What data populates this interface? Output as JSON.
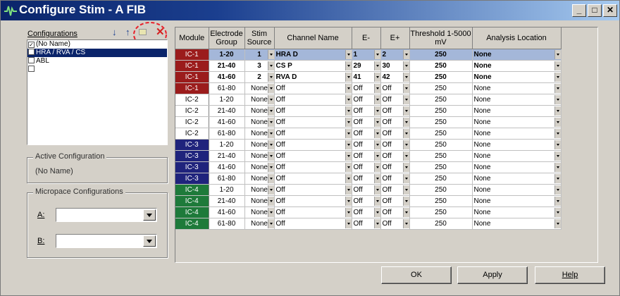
{
  "window": {
    "title": "Configure Stim - A FIB",
    "minimize": "_",
    "maximize": "□",
    "close": "✕"
  },
  "configs": {
    "label": "Configurations",
    "items": [
      {
        "label": "(No Name)",
        "checked": true,
        "selected": false
      },
      {
        "label": "HRA / RVA / CS",
        "checked": false,
        "selected": true
      },
      {
        "label": "ABL",
        "checked": false,
        "selected": false
      },
      {
        "label": "",
        "checked": false,
        "selected": false
      }
    ]
  },
  "active": {
    "label": "Active Configuration",
    "value": "(No Name)"
  },
  "micropace": {
    "label": "Micropace Configurations",
    "a_label": "A:",
    "b_label": "B:",
    "a_value": "",
    "b_value": ""
  },
  "table": {
    "headers": [
      "Module",
      "Electrode Group",
      "Stim Source",
      "Channel Name",
      "E-",
      "E+",
      "Threshold 1-5000 mV",
      "Analysis Location"
    ],
    "rows": [
      [
        "IC-1",
        "1-20",
        "1",
        "HRA D",
        "1",
        "2",
        "250",
        "None"
      ],
      [
        "IC-1",
        "21-40",
        "3",
        "CS P",
        "29",
        "30",
        "250",
        "None"
      ],
      [
        "IC-1",
        "41-60",
        "2",
        "RVA D",
        "41",
        "42",
        "250",
        "None"
      ],
      [
        "IC-1",
        "61-80",
        "None",
        "Off",
        "Off",
        "Off",
        "250",
        "None"
      ],
      [
        "IC-2",
        "1-20",
        "None",
        "Off",
        "Off",
        "Off",
        "250",
        "None"
      ],
      [
        "IC-2",
        "21-40",
        "None",
        "Off",
        "Off",
        "Off",
        "250",
        "None"
      ],
      [
        "IC-2",
        "41-60",
        "None",
        "Off",
        "Off",
        "Off",
        "250",
        "None"
      ],
      [
        "IC-2",
        "61-80",
        "None",
        "Off",
        "Off",
        "Off",
        "250",
        "None"
      ],
      [
        "IC-3",
        "1-20",
        "None",
        "Off",
        "Off",
        "Off",
        "250",
        "None"
      ],
      [
        "IC-3",
        "21-40",
        "None",
        "Off",
        "Off",
        "Off",
        "250",
        "None"
      ],
      [
        "IC-3",
        "41-60",
        "None",
        "Off",
        "Off",
        "Off",
        "250",
        "None"
      ],
      [
        "IC-3",
        "61-80",
        "None",
        "Off",
        "Off",
        "Off",
        "250",
        "None"
      ],
      [
        "IC-4",
        "1-20",
        "None",
        "Off",
        "Off",
        "Off",
        "250",
        "None"
      ],
      [
        "IC-4",
        "21-40",
        "None",
        "Off",
        "Off",
        "Off",
        "250",
        "None"
      ],
      [
        "IC-4",
        "41-60",
        "None",
        "Off",
        "Off",
        "Off",
        "250",
        "None"
      ],
      [
        "IC-4",
        "61-80",
        "None",
        "Off",
        "Off",
        "Off",
        "250",
        "None"
      ]
    ]
  },
  "module_colors": {
    "IC-1": "#9b1c1c",
    "IC-2": "#ffffff",
    "IC-3": "#1f237c",
    "IC-4": "#1e7a3a"
  },
  "module_text_colors": {
    "IC-1": "#ffffff",
    "IC-2": "#000000",
    "IC-3": "#ffffff",
    "IC-4": "#ffffff"
  },
  "buttons": {
    "ok": "OK",
    "apply": "Apply",
    "help": "Help"
  },
  "icons": {
    "app": "waveform-icon",
    "down": "arrow-down-icon",
    "up": "arrow-up-icon",
    "new": "new-config-icon",
    "delete": "delete-x-icon"
  },
  "colors": {
    "title_start": "#0a246a",
    "title_end": "#a6caf0",
    "highlight_circle": "#e8202a",
    "selection": "#0a246a"
  }
}
